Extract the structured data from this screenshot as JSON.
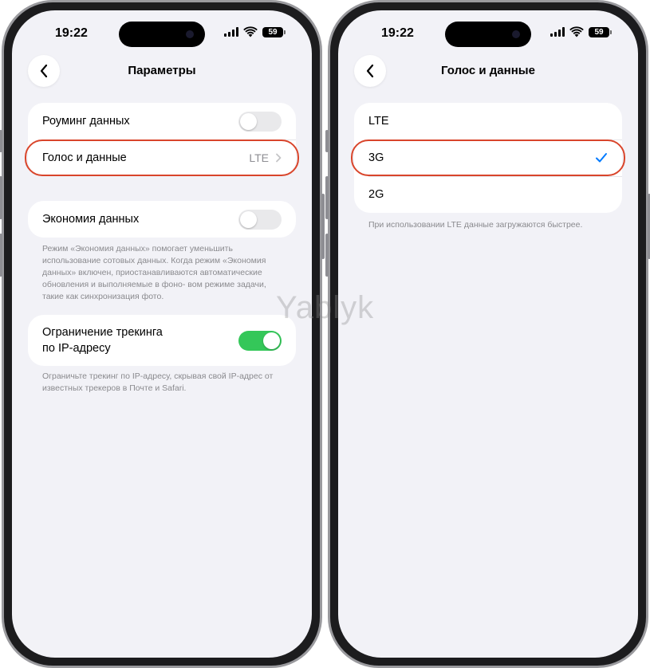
{
  "watermark": "Yablyk",
  "left_phone": {
    "status": {
      "time": "19:22",
      "battery": "59"
    },
    "nav": {
      "title": "Параметры"
    },
    "group1": {
      "roaming_label": "Роуминг данных",
      "voice_label": "Голос и данные",
      "voice_value": "LTE"
    },
    "group2": {
      "saver_label": "Экономия данных"
    },
    "saver_footnote": "Режим «Экономия данных» помогает уменьшить использование сотовых данных. Когда режим «Экономия данных» включен, приостанавливаются автоматические обновления и выполняемые в фоно- вом режиме задачи, такие как синхронизация фото.",
    "group3": {
      "tracking_label_line1": "Ограничение трекинга",
      "tracking_label_line2": "по IP-адресу"
    },
    "tracking_footnote": "Ограничьте трекинг по IP-адресу, скрывая свой IP-адрес от известных трекеров в Почте и Safari."
  },
  "right_phone": {
    "status": {
      "time": "19:22",
      "battery": "59"
    },
    "nav": {
      "title": "Голос и данные"
    },
    "options": [
      "LTE",
      "3G",
      "2G"
    ],
    "selected_option": "3G",
    "footnote": "При использовании LTE данные загружаются быстрее."
  },
  "colors": {
    "toggle_on": "#34c759",
    "highlight": "#d9452b",
    "accent": "#007aff"
  }
}
